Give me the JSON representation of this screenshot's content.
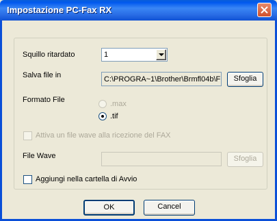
{
  "window": {
    "title": "Impostazione PC-Fax RX"
  },
  "delayed_ring": {
    "label": "Squillo ritardato",
    "value": "1"
  },
  "save_file": {
    "label": "Salva file in",
    "path": "C:\\PROGRA~1\\Brother\\Brmfl04b\\F",
    "browse_label": "Sfoglia"
  },
  "file_format": {
    "label": "Formato File",
    "options": [
      {
        "label": ".max",
        "selected": false,
        "enabled": false
      },
      {
        "label": ".tif",
        "selected": true,
        "enabled": true
      }
    ]
  },
  "wave": {
    "activate_label": "Attiva un file wave alla ricezione del FAX",
    "activate_checked": false,
    "file_label": "File Wave",
    "file_value": "",
    "browse_label": "Sfoglia"
  },
  "startup": {
    "label": "Aggiungi nella cartella di Avvio",
    "checked": false
  },
  "buttons": {
    "ok": "OK",
    "cancel": "Cancel"
  },
  "colors": {
    "titlebar": "#0058ee",
    "dialog_bg": "#ece9d8",
    "close": "#d1502c"
  }
}
